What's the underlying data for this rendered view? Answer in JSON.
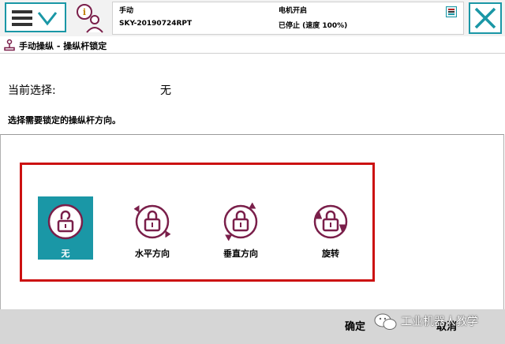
{
  "header": {
    "menu_icon": "hamburger-chevron-down",
    "info_icon": "info-person-icon",
    "mode": "手动",
    "system_name": "SKY-20190724RPT",
    "motor_status": "电机开启",
    "run_status": "已停止 (速度 100%)",
    "close_icon": "close-x"
  },
  "title": {
    "icon": "joystick-icon",
    "text": "手动操纵 - 操纵杆锁定"
  },
  "selection": {
    "current_label": "当前选择:",
    "current_value": "无",
    "instruction": "选择需要锁定的操纵杆方向。"
  },
  "options": [
    {
      "label": "无",
      "icon": "unlock-icon",
      "selected": true
    },
    {
      "label": "水平方向",
      "icon": "lock-horizontal-icon",
      "selected": false
    },
    {
      "label": "垂直方向",
      "icon": "lock-vertical-icon",
      "selected": false
    },
    {
      "label": "旋转",
      "icon": "lock-rotate-icon",
      "selected": false
    }
  ],
  "footer": {
    "ok_label": "确定",
    "cancel_label": "取消",
    "watermark": "工业机器人教学"
  },
  "colors": {
    "accent": "#1a97a6",
    "icon": "#7a1f4a",
    "highlight_border": "#cc1111",
    "bottombar": "#d6d6d6"
  }
}
